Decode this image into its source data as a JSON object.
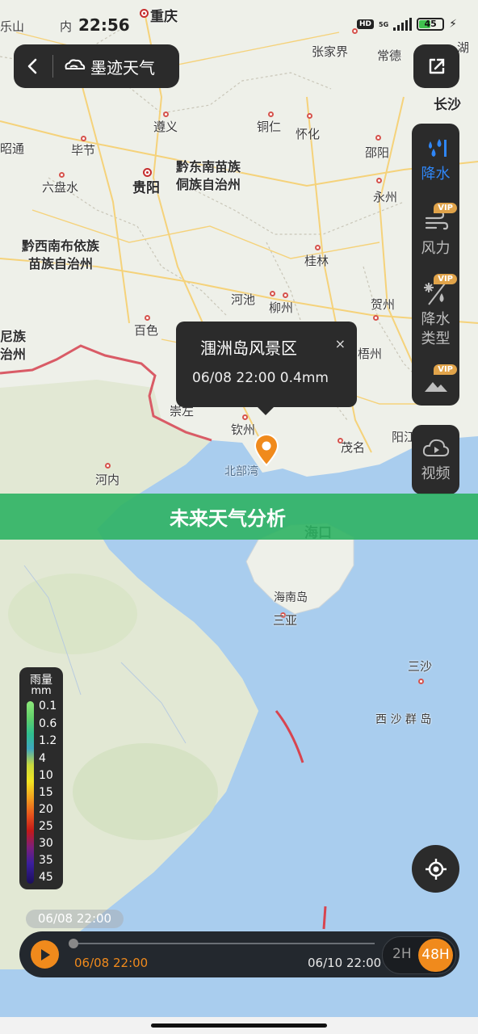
{
  "status_bar": {
    "time": "22:56",
    "network": "5G",
    "hd": "HD",
    "battery": "45"
  },
  "nav": {
    "back_icon": "chevron-left-icon",
    "app_name": "墨迹天气",
    "share_icon": "share-icon"
  },
  "layers": [
    {
      "label": "降水",
      "icon": "rain-drops-icon",
      "active": true,
      "vip": false
    },
    {
      "label": "风力",
      "icon": "wind-icon",
      "active": false,
      "vip": true
    },
    {
      "label": "降水类型",
      "line1": "降水",
      "line2": "类型",
      "icon": "precip-type-icon",
      "active": false,
      "vip": true
    },
    {
      "label": "",
      "icon": "mountain-icon",
      "active": false,
      "vip": true
    }
  ],
  "vip_badge": "VIP",
  "video_button": {
    "label": "视频",
    "icon": "cloud-play-icon"
  },
  "popup": {
    "title": "涠洲岛风景区",
    "value": "06/08 22:00 0.4mm",
    "close": "×"
  },
  "banner": {
    "text": "未来天气分析"
  },
  "map_labels": {
    "chongqing": "重庆",
    "zhangjiajie": "张家界",
    "changde": "常德",
    "changsha": "长沙",
    "zunyi": "遵义",
    "tongren": "铜仁",
    "huaihua": "怀化",
    "shaoyang": "邵阳",
    "bijie": "毕节",
    "liupanshui": "六盘水",
    "guiyang": "贵阳",
    "yongzhou": "永州",
    "qiandongnan": "黔东南苗族\n侗族自治州",
    "qianxinan": "黔西南布依族\n苗族自治州",
    "guilin": "桂林",
    "hechi": "河池",
    "liuzhou": "柳州",
    "hezhou": "贺州",
    "baise": "百色",
    "wuzhou": "梧州",
    "chongzuo": "崇左",
    "qinzhou": "钦州",
    "maoming": "茂名",
    "yangjiang": "阳江",
    "hanoi": "河内",
    "beibuwan": "北部湾",
    "haikou": "海口",
    "hainandao": "海南岛",
    "sanya": "三亚",
    "sansha": "三沙",
    "xisha": "西 沙 群 岛",
    "zhaotong": "昭通",
    "shan": "乐山",
    "nei": "内",
    "hunan": "湖",
    "yun": "尼族\n治州",
    "bu": "部",
    "zhou": "州"
  },
  "legend": {
    "title": "雨量",
    "unit": "mm",
    "ticks": [
      "0.1",
      "0.6",
      "1.2",
      "4",
      "10",
      "15",
      "20",
      "25",
      "30",
      "35",
      "45"
    ]
  },
  "timeline": {
    "current_time": "06/08 22:00",
    "start_time": "06/08 22:00",
    "end_time": "06/10 22:00",
    "speed_options": [
      "2H",
      "48H"
    ],
    "selected_speed": "48H",
    "progress": 0.0
  },
  "colors": {
    "panel": "#2b2b2b",
    "accent_orange": "#f08a1c",
    "active_blue": "#2f86f6",
    "banner_green": "#2eb263",
    "sea": "#a9cdee"
  }
}
